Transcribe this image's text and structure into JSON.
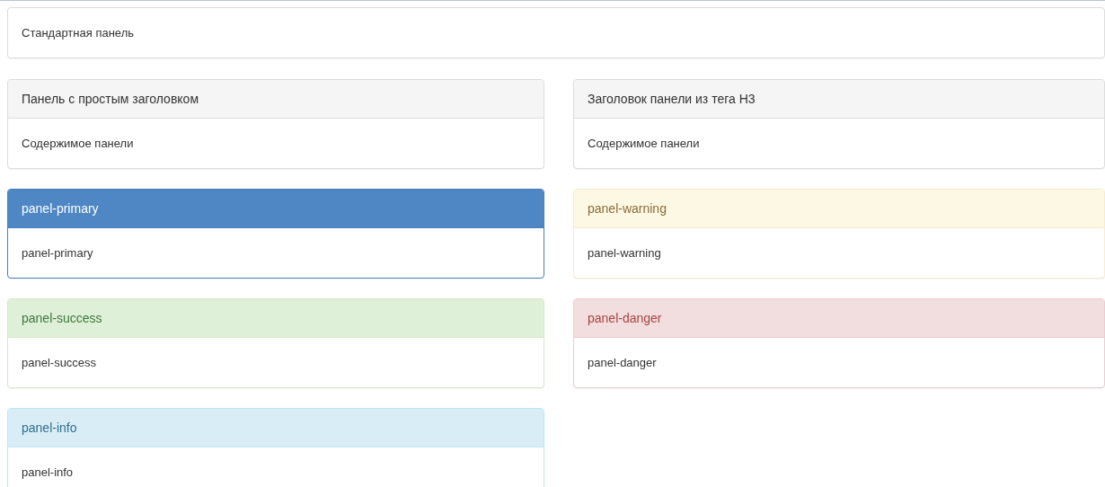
{
  "top_panel": {
    "body": "Стандартная панель"
  },
  "left_column": [
    {
      "kind": "default",
      "heading": "Панель с простым заголовком",
      "body": "Содержимое панели"
    },
    {
      "kind": "primary",
      "heading": "panel-primary",
      "body": "panel-primary"
    },
    {
      "kind": "success",
      "heading": "panel-success",
      "body": "panel-success"
    },
    {
      "kind": "info",
      "heading": "panel-info",
      "body": "panel-info"
    }
  ],
  "right_column": [
    {
      "kind": "default",
      "heading": "Заголовок панели из тега H3",
      "body": "Содержимое панели"
    },
    {
      "kind": "warning",
      "heading": "panel-warning",
      "body": "panel-warning"
    },
    {
      "kind": "danger",
      "heading": "panel-danger",
      "body": "panel-danger"
    }
  ]
}
